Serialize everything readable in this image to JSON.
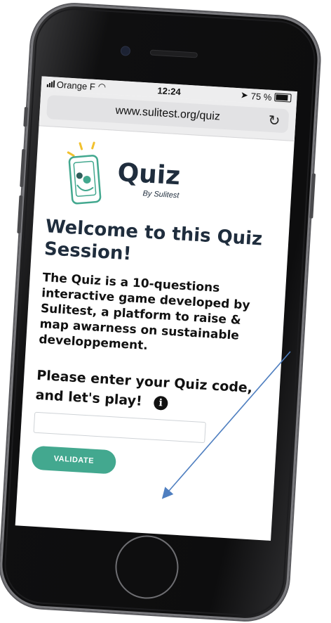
{
  "status_bar": {
    "carrier": "Orange F",
    "time": "12:24",
    "battery": "75 %"
  },
  "browser": {
    "url": "www.sulitest.org/quiz",
    "reload_icon": "reload-icon"
  },
  "logo": {
    "title": "Quiz",
    "subtitle": "By Sulitest"
  },
  "welcome": "Welcome to this Quiz Session!",
  "intro": "The Quiz is a 10-questions interactive game developed by Sulitest, a platform to raise & map awarness on sustainable developpement.",
  "prompt": "Please enter your Quiz code, and let's play!",
  "code_input": {
    "value": "",
    "placeholder": ""
  },
  "validate_label": "VALIDATE",
  "colors": {
    "accent": "#43a88f",
    "heading": "#1f2d3d",
    "logo_yellow": "#f2c12e",
    "arrow": "#4f7fc0"
  }
}
